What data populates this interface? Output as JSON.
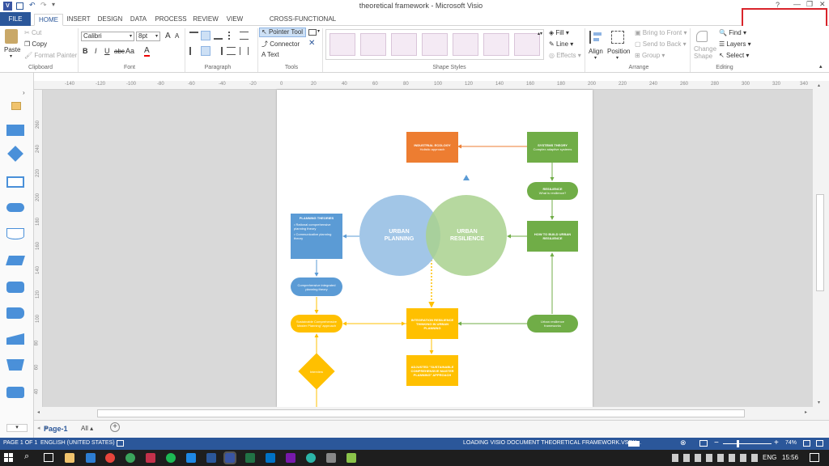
{
  "window": {
    "title": "theoretical framework - Microsoft Visio",
    "help": "?",
    "minimize": "—",
    "restore": "❐",
    "close": "✕"
  },
  "tabs": [
    "FILE",
    "HOME",
    "INSERT",
    "DESIGN",
    "DATA",
    "PROCESS",
    "REVIEW",
    "VIEW",
    "CROSS-FUNCTIONAL FLOWCHART"
  ],
  "ribbon": {
    "clipboard": {
      "paste": "Paste",
      "cut": "Cut",
      "copy": "Copy",
      "format_painter": "Format Painter",
      "label": "Clipboard"
    },
    "font": {
      "name": "Calibri",
      "size": "8pt",
      "grow": "A",
      "shrink": "A",
      "bold": "B",
      "italic": "I",
      "underline": "U",
      "strike": "abc",
      "case": "Aa",
      "color": "A",
      "label": "Font"
    },
    "paragraph": {
      "label": "Paragraph"
    },
    "tools": {
      "pointer": "Pointer Tool",
      "connector": "Connector",
      "text": "Text",
      "label": "Tools"
    },
    "shape_styles": {
      "label": "Shape Styles",
      "fill": "Fill",
      "line": "Line",
      "effects": "Effects"
    },
    "arrange": {
      "align": "Align",
      "position": "Position",
      "bring_front": "Bring to Front",
      "send_back": "Send to Back",
      "group": "Group",
      "label": "Arrange"
    },
    "editing": {
      "change_shape": "Change Shape",
      "find": "Find",
      "layers": "Layers",
      "select": "Select",
      "label": "Editing"
    }
  },
  "ruler_top": [
    "-140",
    "-120",
    "-100",
    "-80",
    "-60",
    "-40",
    "-20",
    "0",
    "20",
    "40",
    "60",
    "80",
    "100",
    "120",
    "140",
    "160",
    "180",
    "200",
    "220",
    "240",
    "260",
    "280",
    "300",
    "320",
    "340"
  ],
  "ruler_left": [
    "260",
    "240",
    "220",
    "200",
    "180",
    "160",
    "140",
    "120",
    "100",
    "80",
    "60",
    "40",
    "20",
    "0"
  ],
  "diagram": {
    "industrial": {
      "title": "INDUSTRIAL ECOLOGY",
      "sub": "Holistic approach"
    },
    "systems": {
      "title": "SYSTEMS THEORY",
      "sub": "Complex adaptive systems"
    },
    "resilience": {
      "title": "RESILIENCE",
      "sub": "What is resilience?"
    },
    "how_to": "HOW TO BUILD URBAN RESILIENCE",
    "planning_theories": {
      "title": "PLANNING THEORIES",
      "item1": "Rational comprehensive planning theory",
      "item2": "Communicative planning theory"
    },
    "urban_planning": "URBAN PLANNING",
    "urban_resilience": "URBAN RESILIENCE",
    "cip": "Comprehensive integrated planning theory",
    "scmp": "Sustainable Comprehensive Master Planning\" approach",
    "integration": "INTEGRATION RESILIENCE THINKING IN URBAN PLANNING",
    "frameworks": "Urban resilience frameworks",
    "adjusted": "ADJUSTED \"SUSTAINABLE COMPREHENSIVE MASTER PLANNING\" APPROACH",
    "interview": "Interview"
  },
  "pagebar": {
    "page": "Page-1",
    "all": "All ▴",
    "add": "+"
  },
  "status": {
    "page": "PAGE 1 OF 1",
    "language": "ENGLISH (UNITED STATES)",
    "loading": "LOADING VISIO DOCUMENT THEORETICAL FRAMEWORK.VSDX...",
    "zoom": "74%"
  },
  "taskbar": {
    "lang": "ENG",
    "time": "15:56"
  },
  "colors": {
    "accent": "#2b579a",
    "orange": "#ed7d31",
    "green": "#70ad47",
    "blue": "#5b9bd5",
    "yellow": "#ffc000",
    "red_box": "#d9242b"
  }
}
